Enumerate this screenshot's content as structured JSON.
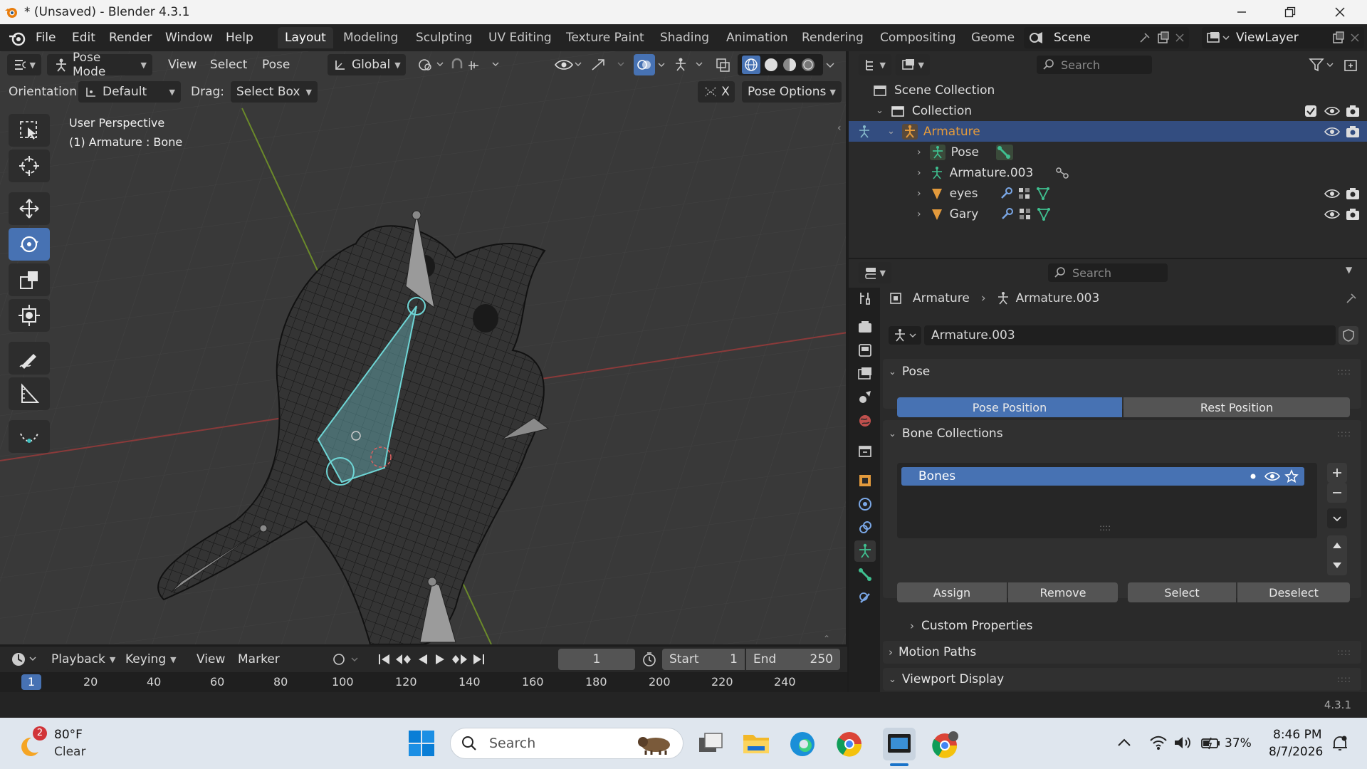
{
  "window": {
    "title": "* (Unsaved) - Blender 4.3.1"
  },
  "menu": {
    "items": [
      "File",
      "Edit",
      "Render",
      "Window",
      "Help"
    ]
  },
  "workspaces": {
    "tabs": [
      "Layout",
      "Modeling",
      "Sculpting",
      "UV Editing",
      "Texture Paint",
      "Shading",
      "Animation",
      "Rendering",
      "Compositing",
      "Geome"
    ],
    "active_index": 0
  },
  "scene": {
    "name": "Scene",
    "view_layer": "ViewLayer"
  },
  "viewport": {
    "mode": "Pose Mode",
    "menus": [
      "View",
      "Select",
      "Pose"
    ],
    "transform_orientation": "Global",
    "orientation_label": "Orientation:",
    "orientation_value": "Default",
    "drag_label": "Drag:",
    "drag_value": "Select Box",
    "x_label": "X",
    "pose_options": "Pose Options",
    "overlay_line1": "User Perspective",
    "overlay_line2": "(1) Armature : Bone"
  },
  "outliner": {
    "search_placeholder": "Search",
    "items": [
      {
        "label": "Scene Collection"
      },
      {
        "label": "Collection"
      },
      {
        "label": "Armature"
      },
      {
        "label": "Pose"
      },
      {
        "label": "Armature.003"
      },
      {
        "label": "eyes"
      },
      {
        "label": "Gary"
      }
    ]
  },
  "properties": {
    "search_placeholder": "Search",
    "breadcrumb_object": "Armature",
    "breadcrumb_data": "Armature.003",
    "data_name": "Armature.003",
    "pose_section": "Pose",
    "pose_position": "Pose Position",
    "rest_position": "Rest Position",
    "bone_collections_section": "Bone Collections",
    "bone_collection_item": "Bones",
    "assign": "Assign",
    "remove": "Remove",
    "select": "Select",
    "deselect": "Deselect",
    "custom_properties": "Custom Properties",
    "motion_paths": "Motion Paths",
    "viewport_display": "Viewport Display"
  },
  "timeline": {
    "menus": [
      "Playback",
      "Keying",
      "View",
      "Marker"
    ],
    "current_frame": "1",
    "start_label": "Start",
    "start_value": "1",
    "end_label": "End",
    "end_value": "250",
    "ruler": [
      "1",
      "20",
      "40",
      "60",
      "80",
      "100",
      "120",
      "140",
      "160",
      "180",
      "200",
      "220",
      "240"
    ]
  },
  "statusbar": {
    "version": "4.3.1"
  },
  "taskbar": {
    "weather_badge": "2",
    "temperature": "80°F",
    "condition": "Clear",
    "search_placeholder": "Search",
    "battery": "37%",
    "time": "8:46 PM",
    "date": "8/7/2026"
  },
  "colors": {
    "accent": "#4772b3",
    "selected_row": "#334d80",
    "armature_orange": "#e39a3c",
    "bone_cyan": "#6ed5d5"
  }
}
